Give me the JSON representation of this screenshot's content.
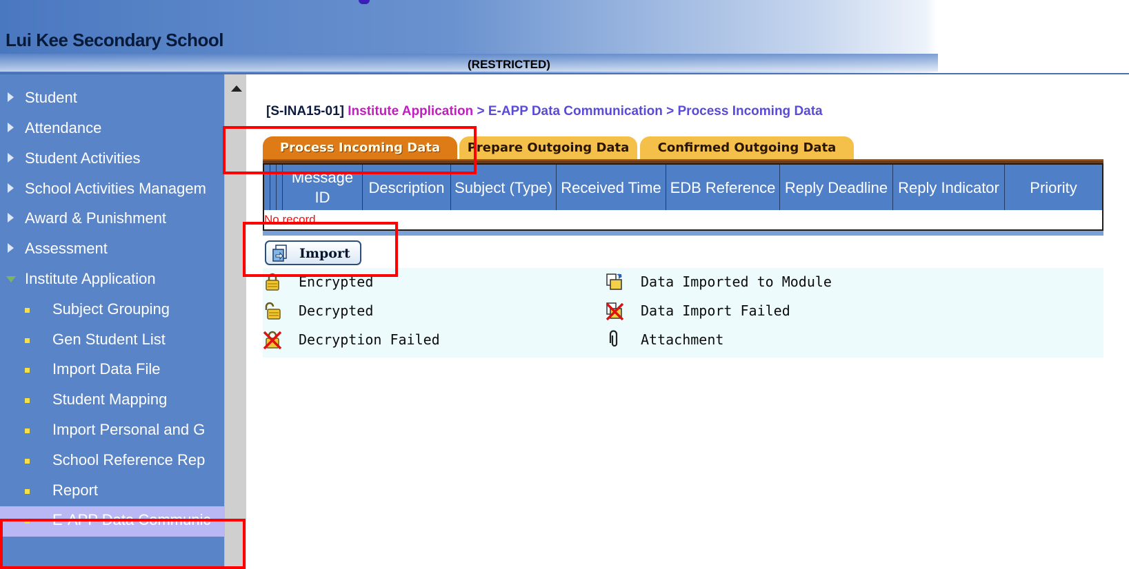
{
  "header": {
    "school_name": "Lui Kee Secondary School",
    "restricted": "(RESTRICTED)"
  },
  "sidebar": {
    "items": [
      {
        "label": "Student",
        "type": "top"
      },
      {
        "label": "Attendance",
        "type": "top"
      },
      {
        "label": "Student Activities",
        "type": "top"
      },
      {
        "label": "School Activities Managem",
        "type": "top"
      },
      {
        "label": "Award & Punishment",
        "type": "top"
      },
      {
        "label": "Assessment",
        "type": "top"
      },
      {
        "label": "Institute Application",
        "type": "open"
      },
      {
        "label": "Subject Grouping",
        "type": "sub"
      },
      {
        "label": "Gen Student List",
        "type": "sub"
      },
      {
        "label": "Import Data File",
        "type": "sub"
      },
      {
        "label": "Student Mapping",
        "type": "sub"
      },
      {
        "label": "Import Personal and G",
        "type": "sub"
      },
      {
        "label": "School Reference Rep",
        "type": "sub"
      },
      {
        "label": "Report",
        "type": "sub"
      },
      {
        "label": "E-APP Data Communic",
        "type": "sub",
        "active": true
      }
    ]
  },
  "breadcrumb": {
    "code": "[S-INA15-01]",
    "part1": "Institute Application",
    "rest": " > E-APP Data Communication > Process Incoming Data"
  },
  "tabs": [
    {
      "label": "Process Incoming Data",
      "active": true
    },
    {
      "label": "Prepare Outgoing Data",
      "active": false
    },
    {
      "label": "Confirmed Outgoing Data",
      "active": false
    }
  ],
  "table": {
    "columns": [
      "Message ID",
      "Description",
      "Subject (Type)",
      "Received Time",
      "EDB Reference",
      "Reply Deadline",
      "Reply Indicator",
      "Priority"
    ],
    "empty_text": "No record."
  },
  "import_button": {
    "label": "Import"
  },
  "legend": [
    {
      "icon": "lock-closed-icon",
      "label": "Encrypted"
    },
    {
      "icon": "document-import-icon",
      "label": "Data Imported to Module"
    },
    {
      "icon": "lock-open-icon",
      "label": "Decrypted"
    },
    {
      "icon": "import-failed-icon",
      "label": "Data Import Failed"
    },
    {
      "icon": "decryption-failed-icon",
      "label": "Decryption Failed"
    },
    {
      "icon": "paperclip-icon",
      "label": "Attachment"
    }
  ],
  "colors": {
    "sidebar_bg": "#5a84c8",
    "active_tab": "#df7b16",
    "inactive_tab": "#f5c04a",
    "table_header": "#4f7fc7",
    "highlight": "#ff0000"
  }
}
